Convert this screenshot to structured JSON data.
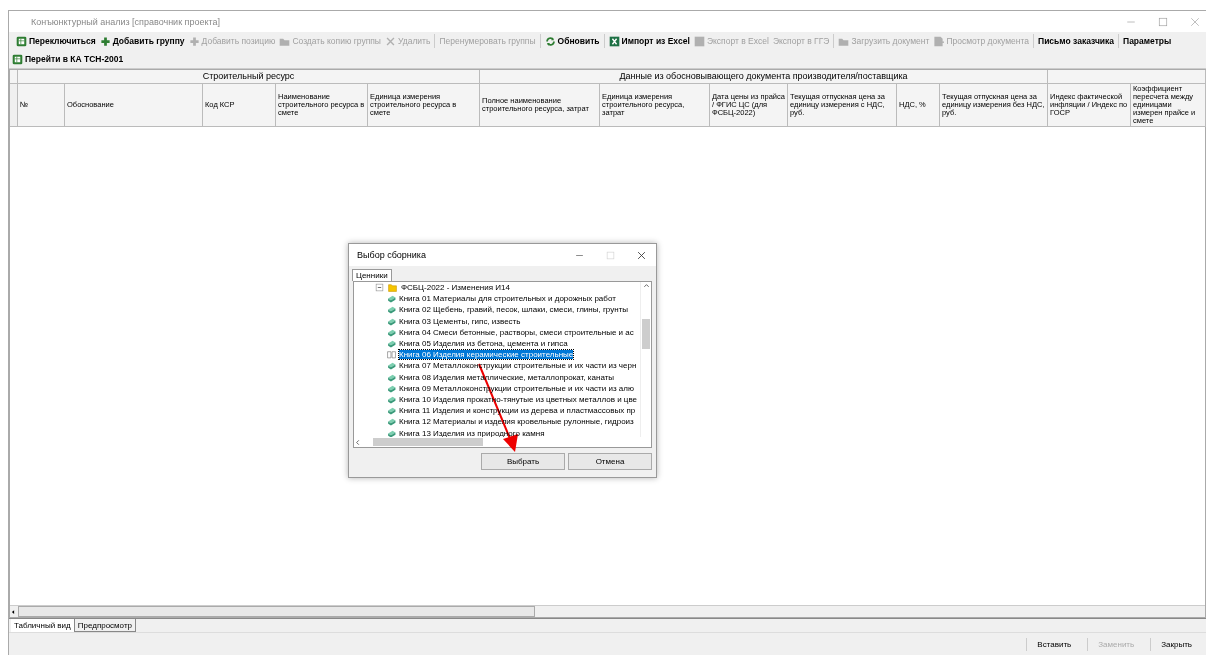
{
  "window": {
    "title": "Конъюнктурный анализ [справочник проекта]"
  },
  "toolbar": {
    "groups": [
      [
        {
          "label": "Переключиться",
          "disabled": false
        },
        {
          "label": "Добавить группу",
          "disabled": false
        },
        {
          "label": "Добавить позицию",
          "disabled": true
        },
        {
          "label": "Создать копию группы",
          "disabled": true
        },
        {
          "label": "Удалить",
          "disabled": true
        }
      ],
      [
        {
          "label": "Перенумеровать группы",
          "disabled": true
        }
      ],
      [
        {
          "label": "Обновить",
          "disabled": false
        }
      ],
      [
        {
          "label": "Импорт из Excel",
          "disabled": false
        },
        {
          "label": "Экспорт в Excel",
          "disabled": true
        },
        {
          "label": "Экспорт в ГГЭ",
          "disabled": true
        }
      ],
      [
        {
          "label": "Загрузить документ",
          "disabled": true
        },
        {
          "label": "Просмотр документа",
          "disabled": true
        }
      ],
      [
        {
          "label": "Письмо заказчика",
          "disabled": false
        }
      ],
      [
        {
          "label": "Параметры",
          "disabled": false
        }
      ]
    ],
    "second_row": [
      {
        "label": "Перейти в КА ТСН-2001",
        "disabled": false
      }
    ]
  },
  "table": {
    "groups": [
      "Строительный ресурс",
      "Данные из обосновывающего документа производителя/поставщика"
    ],
    "columns": [
      "№",
      "Обоснование",
      "Код КСР",
      "Наименование строительного ресурса в смете",
      "Единица измерения строительного ресурса в смете",
      "Полное наименование строительного ресурса, затрат",
      "Единица измерения строительного ресурса, затрат",
      "Дата цены из прайса / ФГИС ЦС (для ФСБЦ-2022)",
      "Текущая отпускная цена за единицу измерения с НДС, руб.",
      "НДС, %",
      "Текущая отпускная цена за единицу измерения без НДС, руб.",
      "Индекс фактической инфляции /  Индекс по  ГОСР",
      "Коэффициент пересчета между единицами измерен прайсе и смете"
    ]
  },
  "view_tabs": [
    {
      "label": "Табличный вид",
      "selected": true
    },
    {
      "label": "Предпросмотр",
      "selected": false
    }
  ],
  "buttons": [
    {
      "label": "Вставить",
      "disabled": false
    },
    {
      "label": "Заменить",
      "disabled": true
    },
    {
      "label": "Закрыть",
      "disabled": false
    }
  ],
  "dialog": {
    "title": "Выбор сборника",
    "tabs": [
      {
        "label": "Ценники",
        "selected": true
      }
    ],
    "tree": [
      {
        "label": "ФСБЦ-2022 - Изменения И14",
        "expanded": true,
        "selected": false,
        "children": [
          {
            "label": "Книга 01 Материалы для строительных и дорожных работ",
            "selected": false
          },
          {
            "label": "Книга 02 Щебень, гравий, песок, шлаки, смеси, глины, грунты",
            "selected": false
          },
          {
            "label": "Книга 03 Цементы, гипс, известь",
            "selected": false
          },
          {
            "label": "Книга 04 Смеси бетонные, растворы, смеси строительные и ас",
            "selected": false
          },
          {
            "label": "Книга 05 Изделия из бетона, цемента и гипса",
            "selected": false
          },
          {
            "label": "Книга 06 Изделия керамические строительные",
            "selected": true
          },
          {
            "label": "Книга 07 Металлоконструкции строительные и их части из черн",
            "selected": false
          },
          {
            "label": "Книга 08 Изделия металлические, металлопрокат, канаты",
            "selected": false
          },
          {
            "label": "Книга 09 Металлоконструкции строительные и их части из алю",
            "selected": false
          },
          {
            "label": "Книга 10 Изделия прокатно-тянутые из цветных металлов и цве",
            "selected": false
          },
          {
            "label": "Книга 11 Изделия и конструкции из дерева и пластмассовых пр",
            "selected": false
          },
          {
            "label": "Книга 12 Материалы и изделия кровельные рулонные, гидроиз",
            "selected": false
          },
          {
            "label": "Книга 13 Изделия из природного камня",
            "selected": false
          }
        ]
      }
    ],
    "buttons": [
      {
        "label": "Выбрать"
      },
      {
        "label": "Отмена"
      }
    ]
  }
}
